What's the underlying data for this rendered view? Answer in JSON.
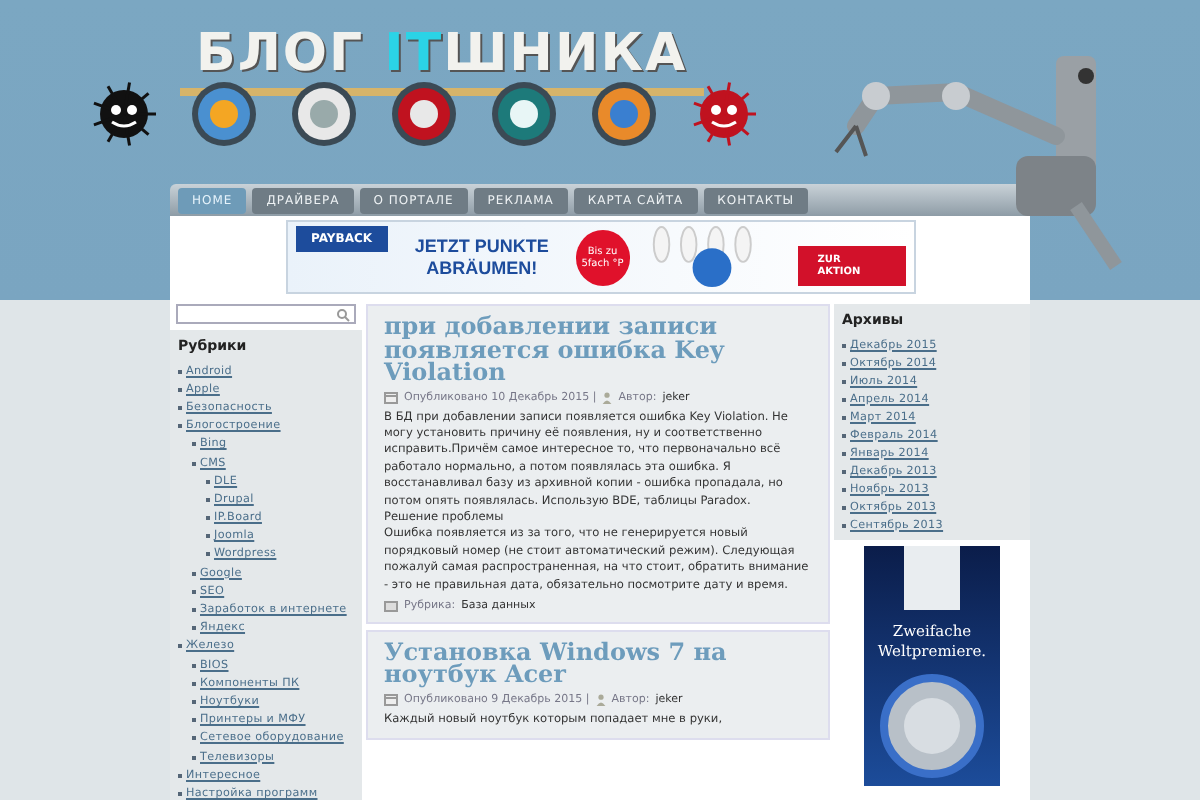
{
  "header": {
    "logo_parts": [
      {
        "text": "БЛОГ ",
        "highlight": false
      },
      {
        "text": "IT",
        "highlight": true
      },
      {
        "text": "ШНИКА",
        "highlight": false
      }
    ]
  },
  "nav": [
    {
      "label": "HOME",
      "selected": true
    },
    {
      "label": "ДРАЙВЕРА",
      "selected": false
    },
    {
      "label": "О ПОРТАЛЕ",
      "selected": false
    },
    {
      "label": "РЕКЛАМА",
      "selected": false
    },
    {
      "label": "КАРТА САЙТА",
      "selected": false
    },
    {
      "label": "КОНТАКТЫ",
      "selected": false
    }
  ],
  "banner_ad": {
    "brand": "PAYBACK",
    "headline": "JETZT PUNKTE ABRÄUMEN!",
    "burst": "Bis zu 5fach °P",
    "cta": "ZUR AKTION"
  },
  "sidebar": {
    "title": "Рубрики",
    "categories": [
      {
        "label": "Android"
      },
      {
        "label": "Apple"
      },
      {
        "label": "Безопасность"
      },
      {
        "label": "Блогостроение",
        "children": [
          {
            "label": "Bing"
          },
          {
            "label": "CMS",
            "children": [
              {
                "label": "DLE"
              },
              {
                "label": "Drupal"
              },
              {
                "label": "IP.Board"
              },
              {
                "label": "Joomla"
              },
              {
                "label": "Wordpress"
              }
            ]
          },
          {
            "label": "Google"
          },
          {
            "label": "SEO"
          },
          {
            "label": "Заработок в интернете"
          },
          {
            "label": "Яндекс"
          }
        ]
      },
      {
        "label": "Железо",
        "children": [
          {
            "label": "BIOS"
          },
          {
            "label": "Компоненты ПК"
          },
          {
            "label": "Ноутбуки"
          },
          {
            "label": "Принтеры и МФУ"
          },
          {
            "label": "Сетевое оборудование"
          },
          {
            "label": "Телевизоры"
          }
        ]
      },
      {
        "label": "Интересное"
      },
      {
        "label": "Настройка программ"
      }
    ]
  },
  "posts": [
    {
      "title": "при добавлении записи появляется ошибка Key Violation",
      "date": "Опубликовано 10 Декабрь 2015 |",
      "author_label": "Автор:",
      "author": "jeker",
      "body": [
        "В БД при добавлении записи появляется ошибка Key Violation. Не могу установить причину её появления, ну и соответственно исправить.Причём самое интересное то, что первоначально всё работало нормально, а потом появлялась эта ошибка. Я восстанавливал базу из архивной копии - ошибка пропадала, но потом опять появлялась. Использую BDE, таблицы Paradox.",
        "Решение проблемы",
        "Ошибка появляется из за того, что не генерируется новый порядковый номер (не стоит автоматический режим). Следующая пожалуй самая распространенная, на что стоит, обратить внимание - это не правильная дата, обязательно посмотрите дату и время."
      ],
      "category_label": "Рубрика:",
      "category": "База данных"
    },
    {
      "title": "Установка Windows 7 на ноутбук Acer",
      "date": "Опубликовано 9 Декабрь 2015 |",
      "author_label": "Автор:",
      "author": "jeker",
      "body": [
        "Каждый новый ноутбук которым попадает мне в руки,"
      ]
    }
  ],
  "archives": {
    "title": "Архивы",
    "items": [
      "Декабрь 2015",
      "Октябрь 2014",
      "Июль 2014",
      "Апрель 2014",
      "Март 2014",
      "Февраль 2014",
      "Январь 2014",
      "Декабрь 2013",
      "Ноябрь 2013",
      "Октябрь 2013",
      "Сентябрь 2013"
    ]
  },
  "side_ad": {
    "headline": "Zweifache Weltpremiere."
  }
}
